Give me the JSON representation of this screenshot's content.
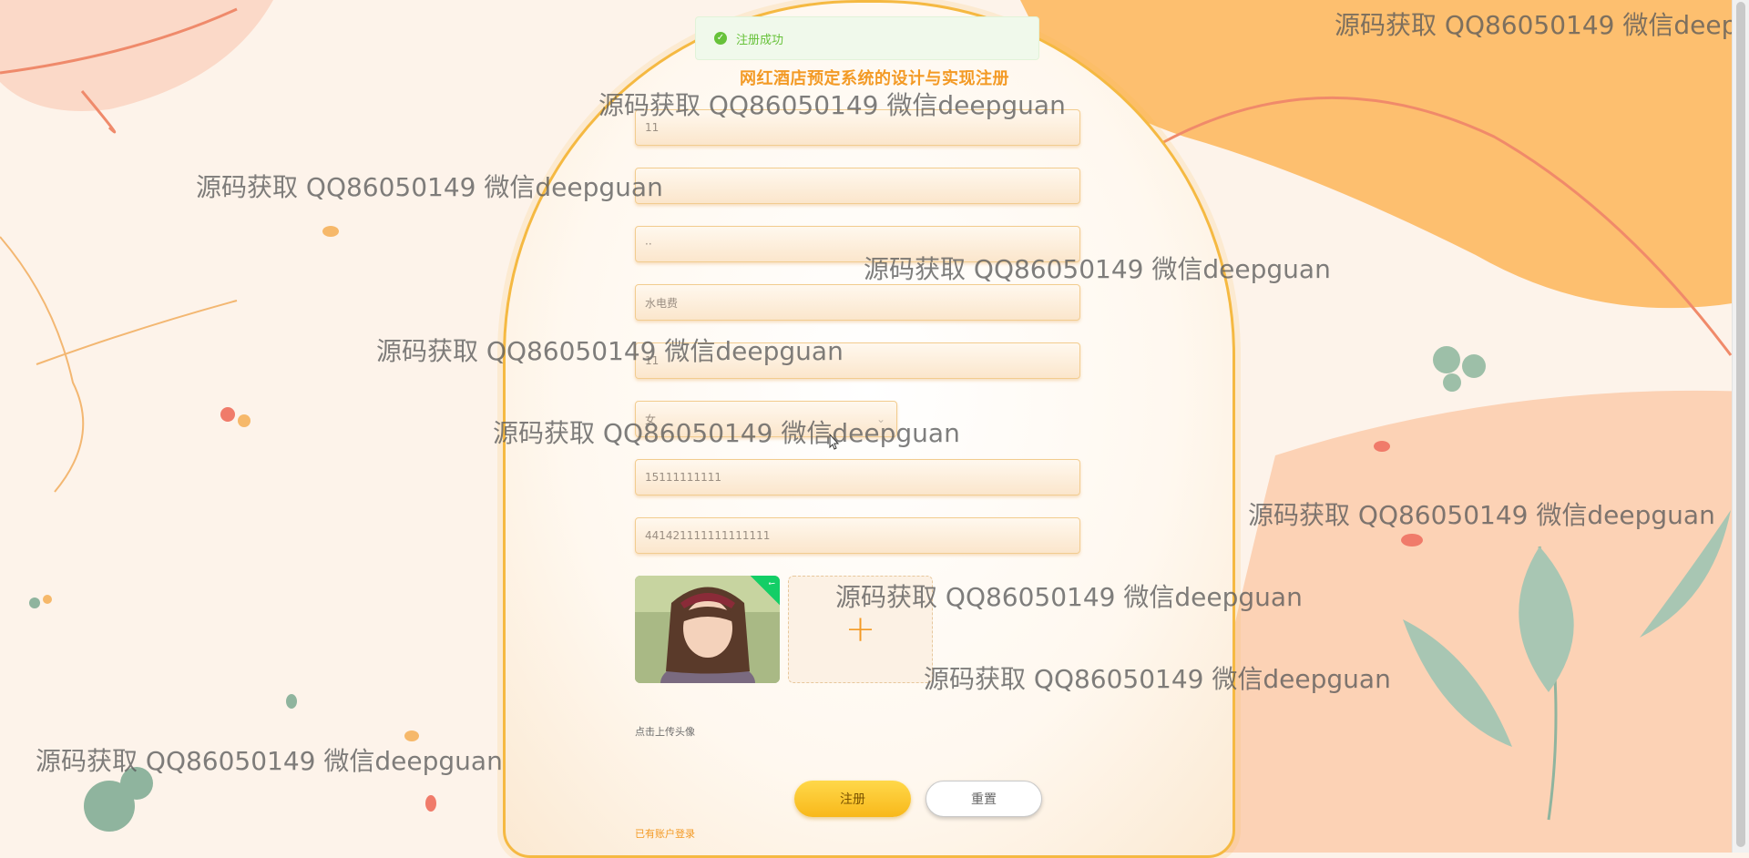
{
  "toast": {
    "message": "注册成功"
  },
  "page_title": "网红酒店预定系统的设计与实现注册",
  "form": {
    "fields": [
      {
        "value": "11"
      },
      {
        "value": ""
      },
      {
        "value": "··"
      },
      {
        "value": "水电费"
      },
      {
        "value": "11"
      },
      {
        "value": "女"
      },
      {
        "value": "15111111111"
      },
      {
        "value": "441421111111111111"
      }
    ],
    "upload_hint": "点击上传头像",
    "register_label": "注册",
    "reset_label": "重置",
    "login_link": "已有账户登录"
  },
  "watermark": "源码获取 QQ86050149 微信deepguan",
  "watermark_edge": "源码获取 QQ86050149 微信deep",
  "colors": {
    "accent": "#f39a25",
    "success": "#67c23a",
    "button": "#f8b81a"
  }
}
